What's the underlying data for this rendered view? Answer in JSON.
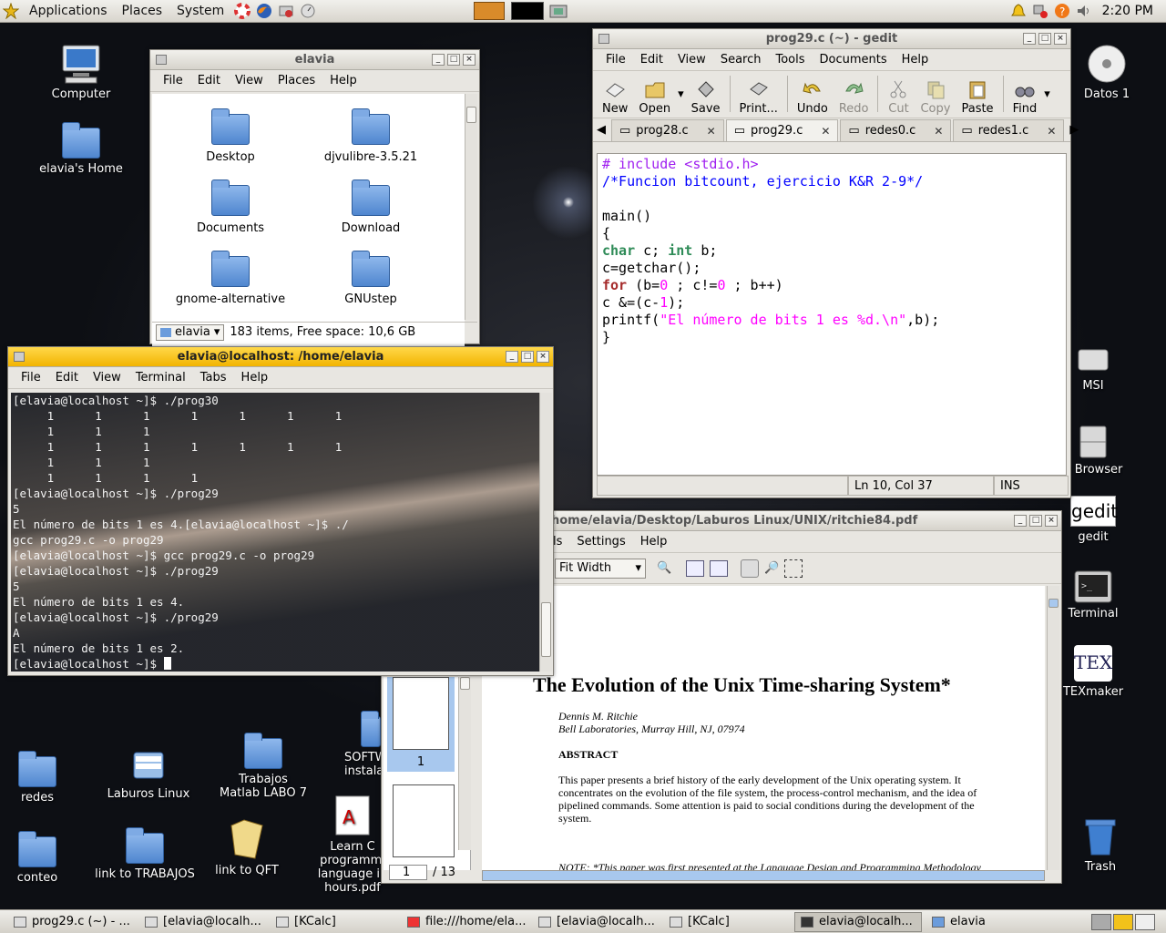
{
  "top_panel": {
    "menus": [
      "Applications",
      "Places",
      "System"
    ],
    "clock": "2:20 PM"
  },
  "desktop_icons": {
    "computer": "Computer",
    "home": "elavia's Home",
    "datos": "Datos 1",
    "msi": "MSI",
    "browser": "e Browser",
    "gedit": "gedit",
    "terminal": "Terminal",
    "texmaker": "TEXmaker",
    "trash": "Trash",
    "redes": "redes",
    "laburos": "Laburos Linux",
    "trabajos_matlab": "Trabajos Matlab LABO 7",
    "softw": "SOFTW instala",
    "conteo": "conteo",
    "link_trabajos": "link to TRABAJOS",
    "link_qft": "link to QFT",
    "learn_c": "Learn C programmi language in hours.pdf"
  },
  "file_manager": {
    "title": "elavia",
    "menus": [
      "File",
      "Edit",
      "View",
      "Places",
      "Help"
    ],
    "items": [
      "Desktop",
      "djvulibre-3.5.21",
      "Documents",
      "Download",
      "gnome-alternative",
      "GNUstep"
    ],
    "location": "elavia",
    "status": "183 items, Free space: 10,6 GB"
  },
  "terminal": {
    "title": "elavia@localhost: /home/elavia",
    "menus": [
      "File",
      "Edit",
      "View",
      "Terminal",
      "Tabs",
      "Help"
    ],
    "lines": [
      "[elavia@localhost ~]$ ./prog30",
      "     1      1      1      1      1      1      1",
      "     1      1      1",
      "     1      1      1      1      1      1      1",
      "     1      1      1",
      "     1      1      1      1",
      "[elavia@localhost ~]$ ./prog29",
      "5",
      "El número de bits 1 es 4.[elavia@localhost ~]$ ./",
      "gcc prog29.c -o prog29",
      "[elavia@localhost ~]$ gcc prog29.c -o prog29",
      "[elavia@localhost ~]$ ./prog29",
      "5",
      "El número de bits 1 es 4.",
      "[elavia@localhost ~]$ ./prog29",
      "A",
      "El número de bits 1 es 2.",
      "[elavia@localhost ~]$ "
    ]
  },
  "gedit": {
    "title": "prog29.c (~) - gedit",
    "menus": [
      "File",
      "Edit",
      "View",
      "Search",
      "Tools",
      "Documents",
      "Help"
    ],
    "toolbar": {
      "new": "New",
      "open": "Open",
      "save": "Save",
      "print": "Print...",
      "undo": "Undo",
      "redo": "Redo",
      "cut": "Cut",
      "copy": "Copy",
      "paste": "Paste",
      "find": "Find"
    },
    "tabs": [
      "prog28.c",
      "prog29.c",
      "redes0.c",
      "redes1.c"
    ],
    "code": {
      "l1": "# include <stdio.h>",
      "l2": "/*Funcion bitcount, ejercicio K&R 2-9*/",
      "l4": "main()",
      "l5": "{",
      "l6_kw1": "char",
      "l6_a": " c; ",
      "l6_kw2": "int",
      "l6_b": " b;",
      "l7": "c=getchar();",
      "l8_kw": "for",
      "l8_a": " (b=",
      "l8_n1": "0",
      "l8_b": " ; c!=",
      "l8_n2": "0",
      "l8_c": " ; b++)",
      "l9_a": "c &=(c-",
      "l9_n": "1",
      "l9_b": ");",
      "l10_a": "printf(",
      "l10_str": "\"El número de bits 1 es %d.\\n\"",
      "l10_b": ",b);",
      "l11": "}"
    },
    "status_pos": "Ln 10, Col 37",
    "status_mode": "INS"
  },
  "pdf": {
    "title": "home/elavia/Desktop/Laburos Linux/UNIX/ritchie84.pdf",
    "menus": [
      "ls",
      "Settings",
      "Help"
    ],
    "zoom": "Fit Width",
    "page_current": "1",
    "page_total": "/ 13",
    "thumb_label": "1",
    "doc_title": "The Evolution of the Unix Time-sharing System*",
    "author": "Dennis M. Ritchie",
    "affiliation": "Bell Laboratories, Murray Hill, NJ, 07974",
    "abstract_heading": "ABSTRACT",
    "abstract": "This paper presents a brief history of the early development of the Unix operating system. It concentrates on the evolution of the file system, the process-control mechanism, and the idea of pipelined commands. Some attention is paid to social conditions during the development of the system.",
    "note": "NOTE: *This paper was first presented at the Language Design and Programming Methodology"
  },
  "taskbar": {
    "tasks": [
      "prog29.c (~) - ...",
      "[elavia@localh...",
      "[KCalc]",
      "file:///home/ela...",
      "[elavia@localh...",
      "[KCalc]",
      "elavia@localh...",
      "elavia"
    ]
  },
  "colors": {
    "active_title": "#f2b400",
    "keyword": "#2e8b57",
    "string": "#ff00ff",
    "preproc": "#a020f0"
  }
}
